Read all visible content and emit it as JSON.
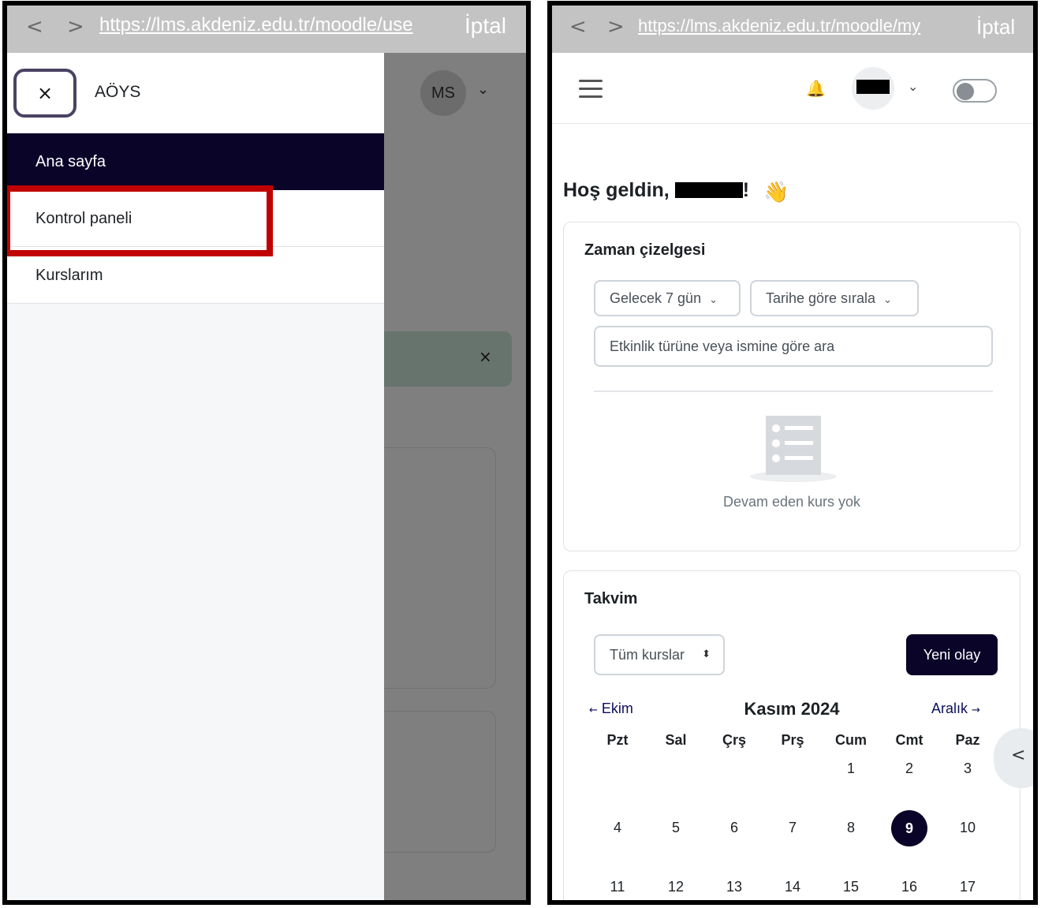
{
  "left": {
    "urlbar": {
      "back": "<",
      "forward": ">",
      "url": "https://lms.akdeniz.edu.tr/moodle/use",
      "cancel": "İptal"
    },
    "background": {
      "avatar_initials": "MS",
      "chevron": "⌄",
      "alert_close": "×"
    },
    "drawer": {
      "close_label": "×",
      "brand": "AÖYS",
      "items": [
        {
          "label": "Ana sayfa",
          "active": true
        },
        {
          "label": "Kontrol paneli",
          "highlighted": true
        },
        {
          "label": "Kurslarım"
        }
      ]
    },
    "highlight_color": "#c00000"
  },
  "right": {
    "urlbar": {
      "back": "<",
      "forward": ">",
      "url": "https://lms.akdeniz.edu.tr/moodle/my",
      "cancel": "İptal"
    },
    "header": {
      "menu_icon": "hamburger-icon",
      "bell_icon": "🔔",
      "chevron": "⌄"
    },
    "welcome": {
      "prefix": "Hoş geldin, ",
      "suffix": "!",
      "emoji": "👋"
    },
    "timeline": {
      "title": "Zaman çizelgesi",
      "range_filter": "Gelecek 7 gün",
      "sort_filter": "Tarihe göre sırala",
      "chevron": "⌄",
      "search_placeholder": "Etkinlik türüne veya ismine göre ara",
      "empty_text": "Devam eden kurs yok"
    },
    "calendar": {
      "title": "Takvim",
      "course_filter": "Tüm kurslar",
      "updown": "⬍",
      "new_event": "Yeni olay",
      "prev_month": "Ekim",
      "next_month": "Aralık",
      "prev_arrow": "←",
      "next_arrow": "→",
      "month_title": "Kasım 2024",
      "weekdays": [
        "Pzt",
        "Sal",
        "Çrş",
        "Prş",
        "Cum",
        "Cmt",
        "Paz"
      ],
      "weeks": [
        [
          "",
          "",
          "",
          "",
          "1",
          "2",
          "3"
        ],
        [
          "4",
          "5",
          "6",
          "7",
          "8",
          "9",
          "10"
        ],
        [
          "11",
          "12",
          "13",
          "14",
          "15",
          "16",
          "17"
        ]
      ],
      "today": "9"
    },
    "side_toggle": "<"
  },
  "colors": {
    "brand_navy": "#0b0429",
    "highlight_red": "#c00000"
  }
}
